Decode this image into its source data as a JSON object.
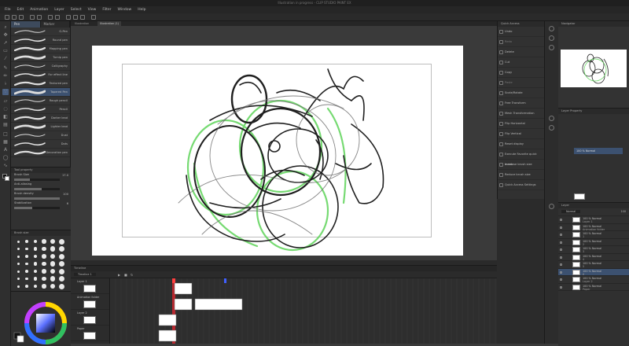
{
  "window": {
    "title": "Illustration in progress - CLIP STUDIO PAINT EX"
  },
  "menu": {
    "items": [
      "File",
      "Edit",
      "Animation",
      "Layer",
      "Select",
      "View",
      "Filter",
      "Window",
      "Help"
    ]
  },
  "document_tabs": [
    "Illustration",
    "Illustration (1)"
  ],
  "brush_panel": {
    "tabs": [
      "Pen",
      "Marker"
    ],
    "brushes": [
      "G-Pen",
      "Round pen",
      "Mapping pen",
      "Turnip pen",
      "Calligraphy",
      "For effect line",
      "Textured pen",
      "Tapered Pen",
      "Rough pencil",
      "Pencil",
      "Darker lead",
      "Lighter lead",
      "Dust",
      "Dots",
      "Decoration pen"
    ],
    "selected_index": 7
  },
  "tool_property": {
    "title": "Tool property",
    "rows": [
      {
        "label": "Brush Size",
        "value": "17.0",
        "level": 0.35
      },
      {
        "label": "Anti-aliasing",
        "value": "",
        "level": 0.6
      },
      {
        "label": "Brush density",
        "value": "100",
        "level": 1.0
      },
      {
        "label": "Stabilization",
        "value": "6",
        "level": 0.4
      }
    ]
  },
  "material_panel": {
    "title": "Brush size"
  },
  "quick_access": {
    "title": "Quick Access",
    "items": [
      {
        "label": "Undo",
        "enabled": true
      },
      {
        "label": "Redo",
        "enabled": false
      },
      {
        "label": "Delete",
        "enabled": true
      },
      {
        "label": "Cut",
        "enabled": true
      },
      {
        "label": "Copy",
        "enabled": true
      },
      {
        "label": "Paste",
        "enabled": false
      },
      {
        "label": "Scale/Rotate",
        "enabled": true
      },
      {
        "label": "Free Transform",
        "enabled": true
      },
      {
        "label": "Mesh Transformation",
        "enabled": true
      },
      {
        "label": "Flip Horizontal",
        "enabled": true
      },
      {
        "label": "Flip Vertical",
        "enabled": true
      },
      {
        "label": "Reset display",
        "enabled": true
      },
      {
        "label": "Execute Favorite quick mask",
        "enabled": true
      },
      {
        "label": "Increase brush size",
        "enabled": true
      },
      {
        "label": "Reduce brush size",
        "enabled": true
      },
      {
        "label": "Quick Access Settings",
        "enabled": true
      }
    ]
  },
  "navigator": {
    "title": "Navigator"
  },
  "layer_property": {
    "title": "Layer Property",
    "layer_label": "100 % Normal"
  },
  "layers": {
    "title": "Layer",
    "blend": "Normal",
    "opacity": "100",
    "rows": [
      {
        "name": "100 % Normal",
        "sub": "Layer 1",
        "selected": false
      },
      {
        "name": "100 % Normal",
        "sub": "Animation folder",
        "selected": false
      },
      {
        "name": "100 % Normal",
        "sub": "1",
        "selected": false
      },
      {
        "name": "100 % Normal",
        "sub": "2",
        "selected": false
      },
      {
        "name": "100 % Normal",
        "sub": "3",
        "selected": false
      },
      {
        "name": "100 % Normal",
        "sub": "4",
        "selected": false
      },
      {
        "name": "100 % Normal",
        "sub": "5",
        "selected": false
      },
      {
        "name": "100 % Normal",
        "sub": "6",
        "selected": true
      },
      {
        "name": "100 % Normal",
        "sub": "Layer 2",
        "selected": false
      },
      {
        "name": "100 % Normal",
        "sub": "Paper",
        "selected": false
      }
    ]
  },
  "timeline": {
    "title": "Timeline",
    "timeline_name": "Timeline 1",
    "tracks": [
      "Layer 1",
      "Animation folder",
      "Layer 2",
      "Paper"
    ]
  },
  "colors": {
    "accent": "#3c5170",
    "playhead": "#d0262e",
    "sketch_green": "#5fd45a",
    "ink": "#1f1f1f"
  }
}
